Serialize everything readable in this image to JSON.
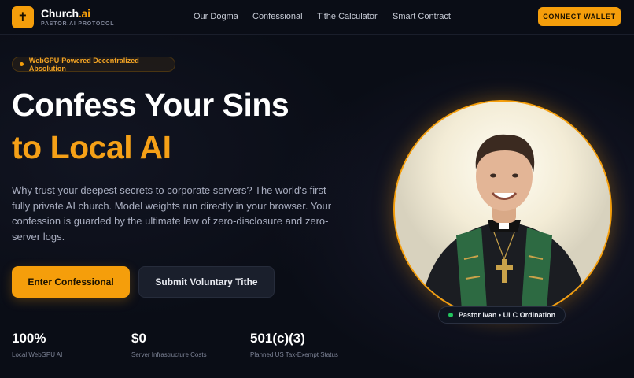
{
  "brand": {
    "name_main": "Church",
    "name_accent": ".ai",
    "subtitle": "PASTOR.AI PROTOCOL",
    "logo_glyph": "✝"
  },
  "nav": {
    "links": [
      "Our Dogma",
      "Confessional",
      "Tithe Calculator",
      "Smart Contract"
    ],
    "wallet_label": "CONNECT WALLET"
  },
  "hero": {
    "badge": "WebGPU-Powered Decentralized Absolution",
    "title_line1": "Confess Your Sins",
    "title_line2": "to Local AI",
    "lead": "Why trust your deepest secrets to corporate servers? The world's first fully private AI church. Model weights run directly in your browser. Your confession is guarded by the ultimate law of zero-disclosure and zero-server logs.",
    "primary_cta": "Enter Confessional",
    "secondary_cta": "Submit Voluntary Tithe"
  },
  "stats": [
    {
      "value": "100%",
      "label": "Local WebGPU AI"
    },
    {
      "value": "$0",
      "label": "Server Infrastructure Costs"
    },
    {
      "value": "501(c)(3)",
      "label": "Planned US Tax-Exempt Status"
    }
  ],
  "portrait": {
    "caption": "Pastor Ivan • ULC Ordination"
  },
  "colors": {
    "accent": "#f59e0b",
    "background": "#0a0d16",
    "status_online": "#22c55e"
  }
}
